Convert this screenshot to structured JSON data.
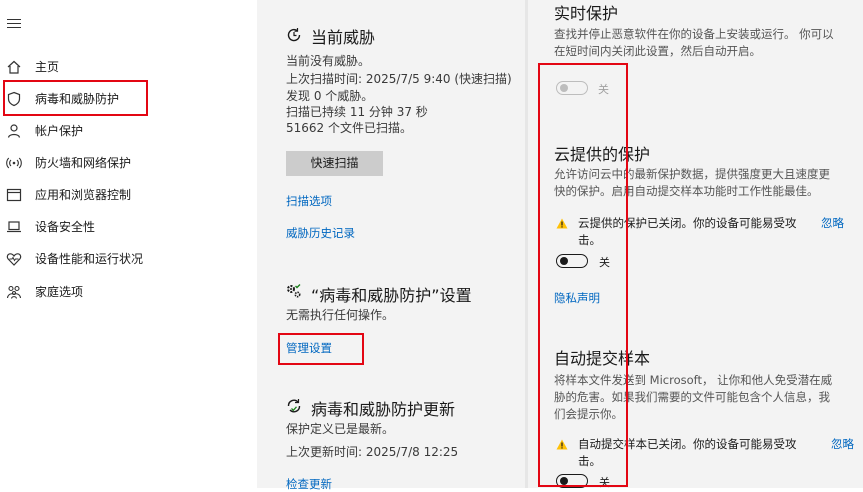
{
  "nav": {
    "items": [
      {
        "label": "主页",
        "icon": "home-icon"
      },
      {
        "label": "病毒和威胁防护",
        "icon": "shield-icon"
      },
      {
        "label": "帐户保护",
        "icon": "person-icon"
      },
      {
        "label": "防火墙和网络保护",
        "icon": "wifi-signal-icon"
      },
      {
        "label": "应用和浏览器控制",
        "icon": "browser-window-icon"
      },
      {
        "label": "设备安全性",
        "icon": "laptop-icon"
      },
      {
        "label": "设备性能和运行状况",
        "icon": "heart-icon"
      },
      {
        "label": "家庭选项",
        "icon": "family-icon"
      }
    ]
  },
  "current_threats": {
    "title": "当前威胁",
    "lines": [
      "当前没有威胁。",
      "上次扫描时间: 2025/7/5 9:40 (快速扫描)",
      "发现 0 个威胁。",
      "扫描已持续 11 分钟 37 秒",
      "51662 个文件已扫描。"
    ],
    "quick_scan_label": "快速扫描",
    "scan_options_link": "扫描选项",
    "history_link": "威胁历史记录"
  },
  "settings": {
    "title": "“病毒和威胁防护”设置",
    "status": "无需执行任何操作。",
    "manage_link": "管理设置"
  },
  "updates": {
    "title": "病毒和威胁防护更新",
    "status": "保护定义已是最新。",
    "last_update": "上次更新时间: 2025/7/8 12:25",
    "check_link": "检查更新"
  },
  "realtime": {
    "title": "实时保护",
    "desc": "查找并停止恶意软件在你的设备上安装或运行。 你可以在短时间内关闭此设置，然后自动开启。",
    "toggle_label": "关"
  },
  "cloud": {
    "title": "云提供的保护",
    "desc": "允许访问云中的最新保护数据，提供强度更大且速度更快的保护。启用自动提交样本功能时工作性能最佳。",
    "warning": "云提供的保护已关闭。你的设备可能易受攻击。",
    "dismiss": "忽略",
    "toggle_label": "关",
    "privacy_link": "隐私声明"
  },
  "sample": {
    "title": "自动提交样本",
    "desc": "将样本文件发送到 Microsoft， 让你和他人免受潜在威胁的危害。如果我们需要的文件可能包含个人信息，我们会提示你。",
    "warning": "自动提交样本已关闭。你的设备可能易受攻击。",
    "dismiss": "忽略",
    "toggle_label": "关"
  },
  "colors": {
    "accent": "#0067c0",
    "highlight": "#e30613",
    "warning": "#ffc107"
  }
}
